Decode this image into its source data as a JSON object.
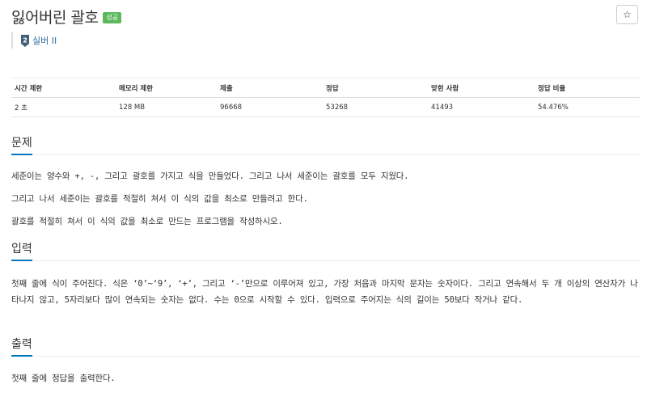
{
  "problem": {
    "title": "잃어버린 괄호",
    "status_badge": "성공",
    "tier_label": "실버 II",
    "tier_number": "2",
    "star_icon": "☆"
  },
  "info_table": {
    "headers": [
      "시간 제한",
      "메모리 제한",
      "제출",
      "정답",
      "맞힌 사람",
      "정답 비율"
    ],
    "values": [
      "2 초",
      "128 MB",
      "96668",
      "53268",
      "41493",
      "54.476%"
    ]
  },
  "sections": {
    "description": {
      "heading": "문제",
      "paragraphs": [
        "세준이는 양수와 +, -, 그리고 괄호를 가지고 식을 만들었다. 그리고 나서 세준이는 괄호를 모두 지웠다.",
        "그리고 나서 세준이는 괄호를 적절히 쳐서 이 식의 값을 최소로 만들려고 한다.",
        "괄호를 적절히 쳐서 이 식의 값을 최소로 만드는 프로그램을 작성하시오."
      ]
    },
    "input": {
      "heading": "입력",
      "paragraph": "첫째 줄에 식이 주어진다. 식은 ‘0’~‘9’, ‘+’, 그리고 ‘-’만으로 이루어져 있고, 가장 처음과 마지막 문자는 숫자이다. 그리고 연속해서 두 개 이상의 연산자가 나타나지 않고, 5자리보다 많이 연속되는 숫자는 없다. 수는 0으로 시작할 수 있다. 입력으로 주어지는 식의 길이는 50보다 작거나 같다."
    },
    "output": {
      "heading": "출력",
      "paragraph": "첫째 줄에 정답을 출력한다."
    }
  },
  "colors": {
    "status_green": "#5cb85c",
    "section_underline": "#0076c0",
    "tier_blue": "#2e6b9e"
  }
}
